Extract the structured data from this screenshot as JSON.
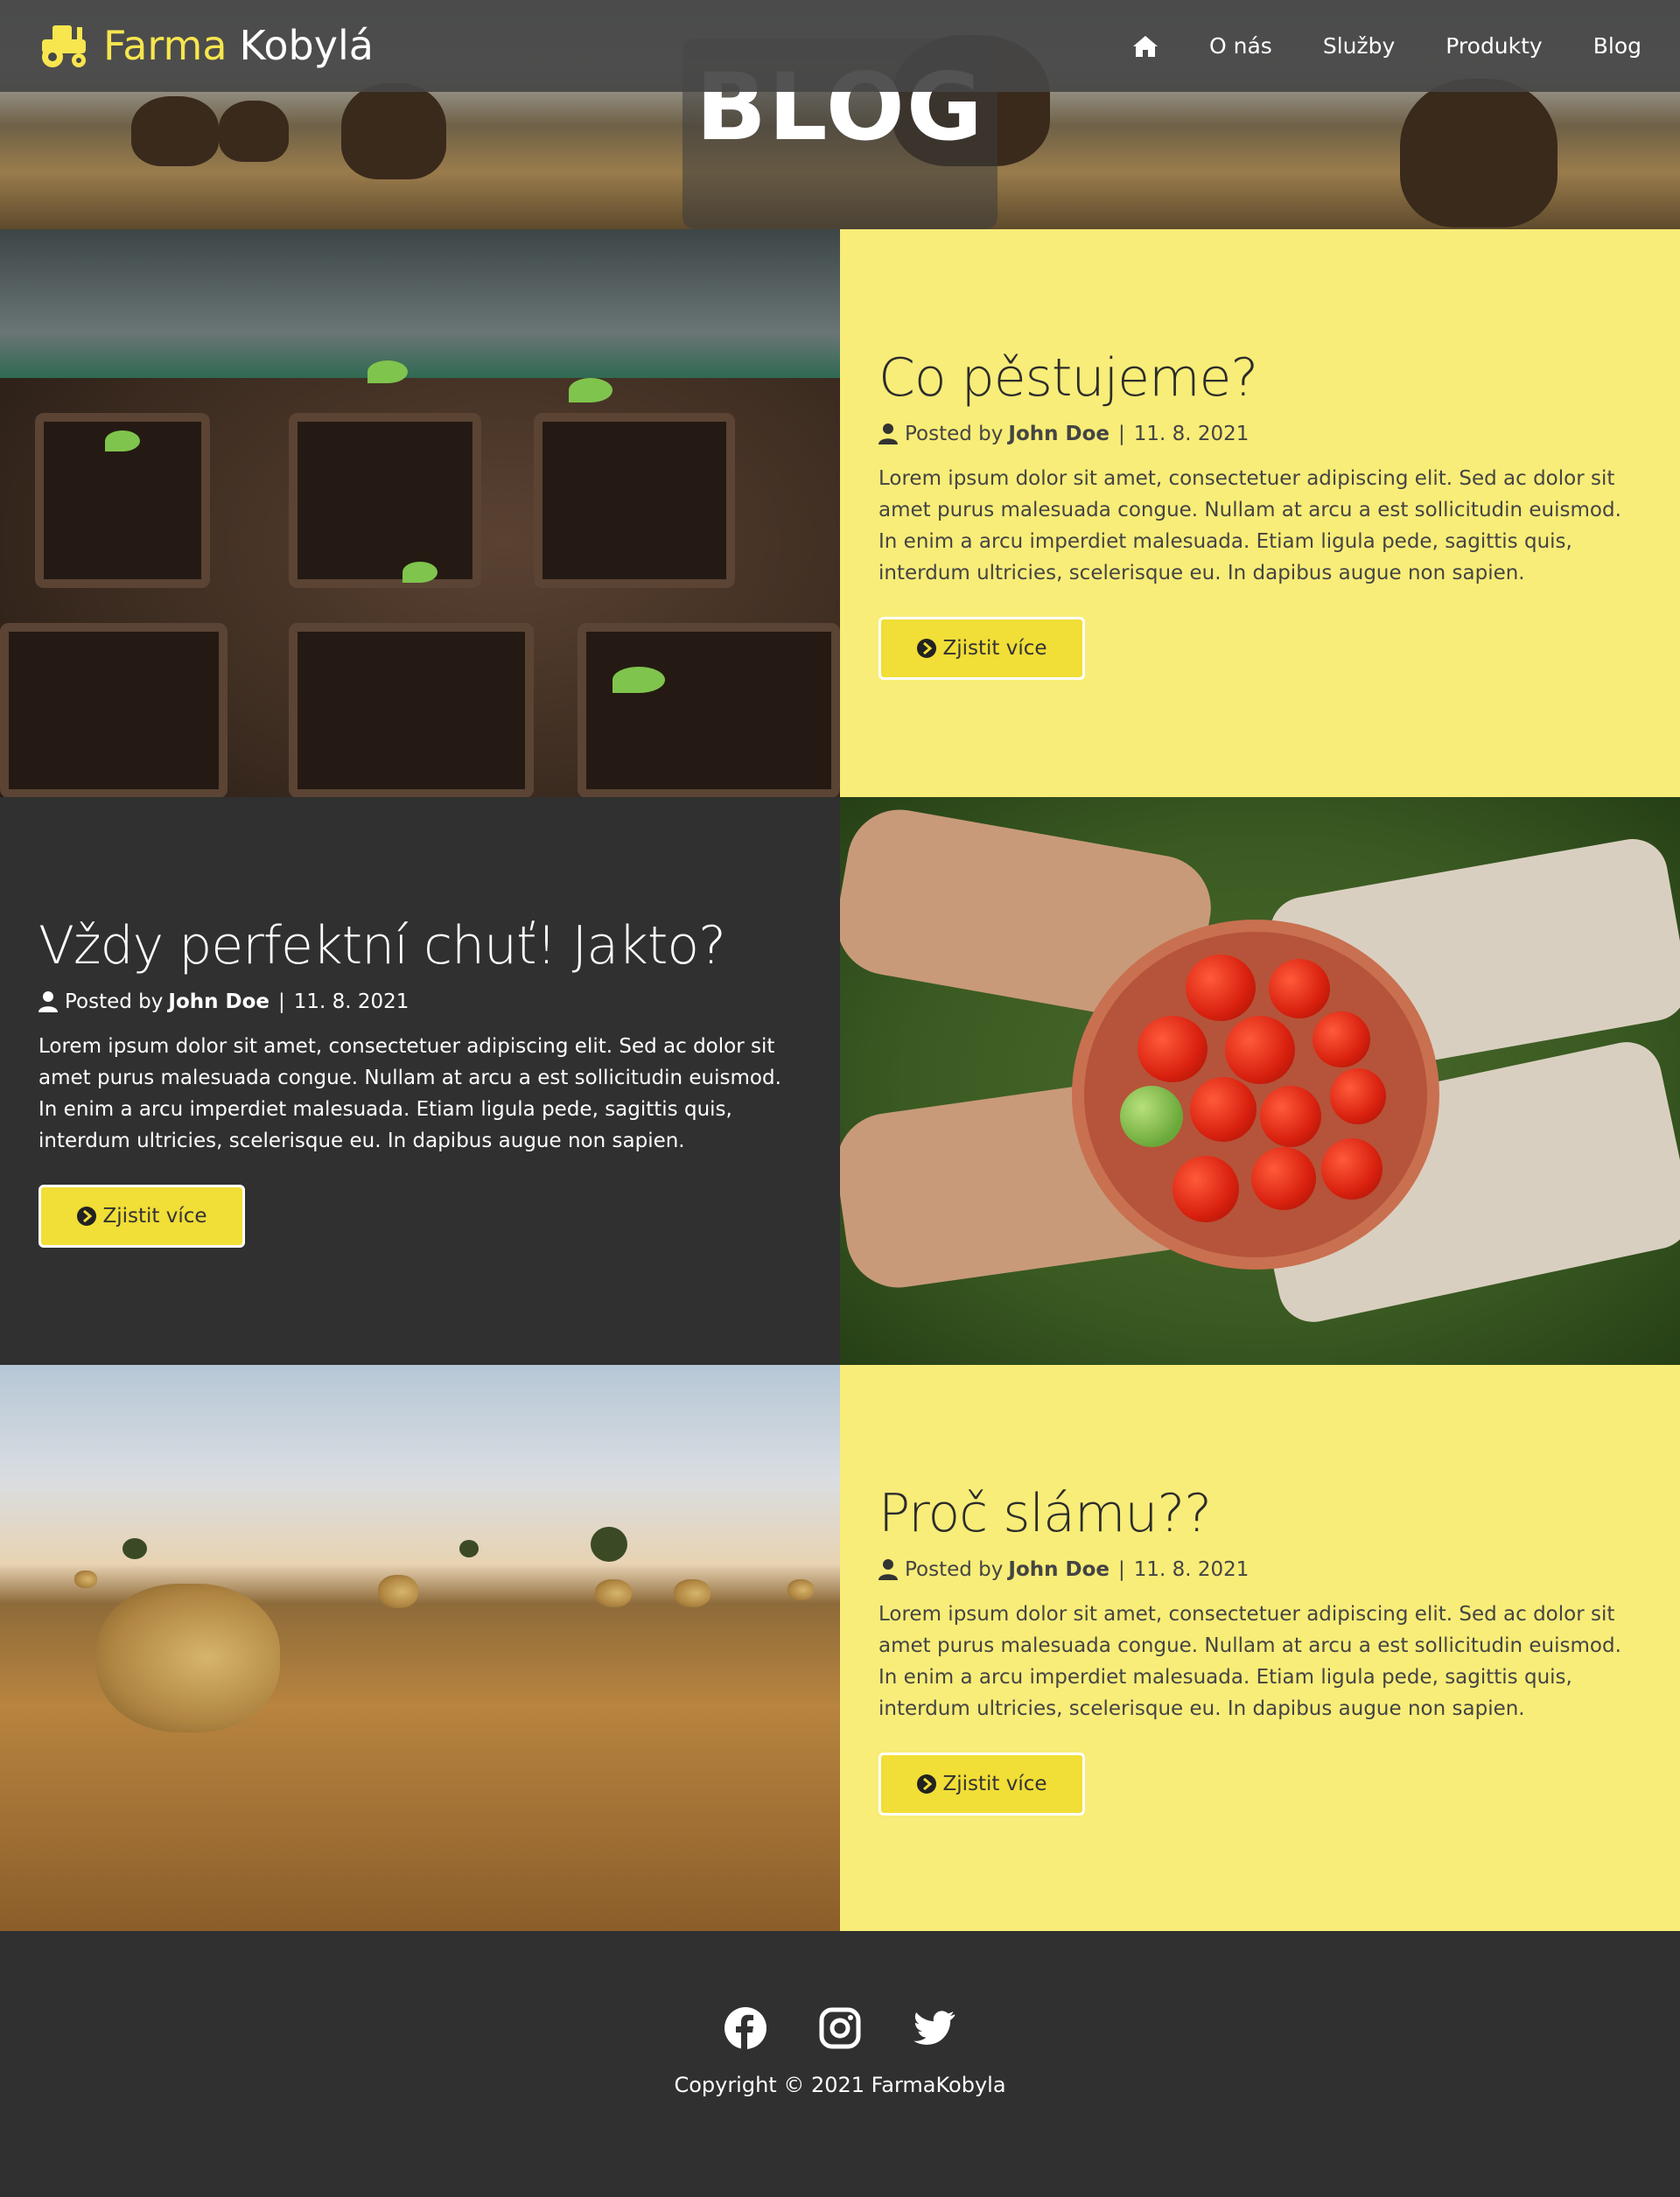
{
  "brand": {
    "name_highlight": "Farma",
    "name_rest": "Kobylá"
  },
  "nav": {
    "home_icon": "home-icon",
    "items": [
      "O nás",
      "Služby",
      "Produkty",
      "Blog"
    ]
  },
  "header": {
    "title": "BLOG"
  },
  "posts": [
    {
      "title": "Co pěstujeme?",
      "posted_by": "Posted by",
      "author": "John Doe",
      "separator": "|",
      "date": "11. 8. 2021",
      "excerpt": "Lorem ipsum dolor sit amet, consectetuer adipiscing elit. Sed ac dolor sit amet purus malesuada congue. Nullam at arcu a est sollicitudin euismod. In enim a arcu imperdiet malesuada. Etiam ligula pede, sagittis quis, interdum ultricies, scelerisque eu. In dapibus augue non sapien.",
      "button": "Zjistit více",
      "theme": "yellow",
      "image": "seedlings-photo"
    },
    {
      "title": "Vždy perfektní chuť! Jakto?",
      "posted_by": "Posted by",
      "author": "John Doe",
      "separator": "|",
      "date": "11. 8. 2021",
      "excerpt": "Lorem ipsum dolor sit amet, consectetuer adipiscing elit. Sed ac dolor sit amet purus malesuada congue. Nullam at arcu a est sollicitudin euismod. In enim a arcu imperdiet malesuada. Etiam ligula pede, sagittis quis, interdum ultricies, scelerisque eu. In dapibus augue non sapien.",
      "button": "Zjistit více",
      "theme": "dark",
      "image": "tomatoes-photo"
    },
    {
      "title": "Proč slámu??",
      "posted_by": "Posted by",
      "author": "John Doe",
      "separator": "|",
      "date": "11. 8. 2021",
      "excerpt": "Lorem ipsum dolor sit amet, consectetuer adipiscing elit. Sed ac dolor sit amet purus malesuada congue. Nullam at arcu a est sollicitudin euismod. In enim a arcu imperdiet malesuada. Etiam ligula pede, sagittis quis, interdum ultricies, scelerisque eu. In dapibus augue non sapien.",
      "button": "Zjistit více",
      "theme": "yellow",
      "image": "hay-field-photo"
    }
  ],
  "footer": {
    "social_icons": [
      "facebook-icon",
      "instagram-icon",
      "twitter-icon"
    ],
    "copyright": "Copyright © 2021 FarmaKobyla"
  },
  "colors": {
    "accent_yellow": "#f8ed78",
    "button_yellow": "#f1de36",
    "brand_yellow": "#f7e64e",
    "dark": "#303030"
  }
}
